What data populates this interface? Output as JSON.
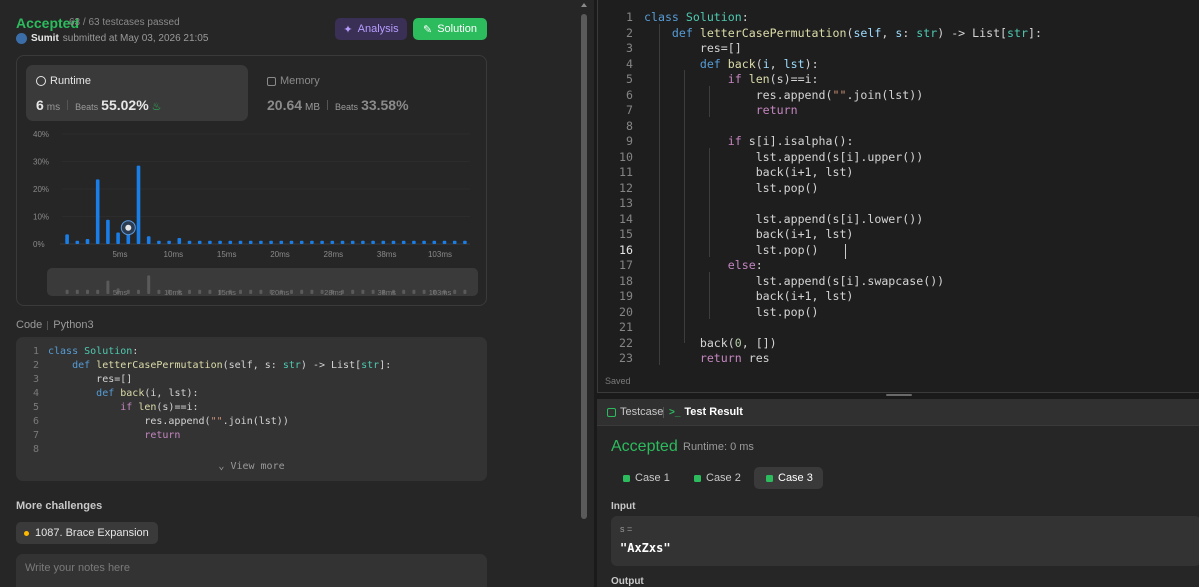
{
  "submission": {
    "status": "Accepted",
    "passed": "63 / 63 testcases passed",
    "user": "Sumit",
    "submitted_text": "submitted at May 03, 2026 21:05",
    "analysis_label": "Analysis",
    "solution_label": "Solution"
  },
  "runtime": {
    "label": "Runtime",
    "value": "6",
    "unit": "ms",
    "beats_label": "Beats",
    "beats": "55.02%"
  },
  "memory": {
    "label": "Memory",
    "value": "20.64",
    "unit": "MB",
    "beats_label": "Beats",
    "beats": "33.58%"
  },
  "chart_data": {
    "type": "bar",
    "title": "",
    "xlabel": "",
    "ylabel": "",
    "ylim": [
      0,
      40
    ],
    "y_ticks": [
      "40%",
      "30%",
      "20%",
      "10%",
      "0%"
    ],
    "x_tick_labels": [
      "5ms",
      "10ms",
      "15ms",
      "20ms",
      "28ms",
      "38ms",
      "103ms"
    ],
    "values": [
      3.5,
      1.2,
      1.8,
      23.5,
      8.8,
      4.2,
      5.2,
      28.5,
      2.8,
      1.2,
      1.2,
      2.2,
      1.2,
      1.2,
      1.2,
      1.2,
      1.2,
      1.2,
      1.2,
      1.2,
      1.2,
      1.2,
      1.2,
      1.2,
      1.2,
      1.2,
      1.2,
      1.2,
      1.2,
      1.2,
      1.2,
      1.2,
      1.2,
      1.2,
      1.2,
      1.2,
      1.2,
      1.2,
      1.2,
      1.2
    ],
    "highlight_index": 6,
    "bar_color": "#1a7ee8",
    "mini_values": [
      1,
      1,
      1,
      1,
      8,
      2,
      1,
      1,
      12,
      1,
      1,
      1,
      1,
      1,
      1,
      1,
      1,
      1,
      1,
      1,
      1,
      1,
      1,
      1,
      1,
      1,
      1,
      1,
      1,
      1,
      1,
      1,
      1,
      1,
      1,
      1,
      1,
      1,
      1,
      1
    ]
  },
  "code_section": {
    "label": "Code",
    "language": "Python3",
    "view_more": "View more"
  },
  "more": {
    "title": "More challenges",
    "challenge": "1087. Brace Expansion",
    "notes_placeholder": "Write your notes here"
  },
  "editor": {
    "status": "Saved",
    "cursor_line": 16
  },
  "test_panel": {
    "tab_testcase": "Testcase",
    "tab_result": "Test Result",
    "result": "Accepted",
    "runtime_text": "Runtime: 0 ms",
    "cases": [
      "Case 1",
      "Case 2",
      "Case 3"
    ],
    "active_case": 2,
    "input_label": "Input",
    "var_label": "s =",
    "input_value": "\"AxZxs\"",
    "output_label": "Output"
  },
  "colors": {
    "accent_green": "#2cbb5d",
    "bar_blue": "#1a7ee8",
    "analysis_purple": "#b69cff"
  }
}
